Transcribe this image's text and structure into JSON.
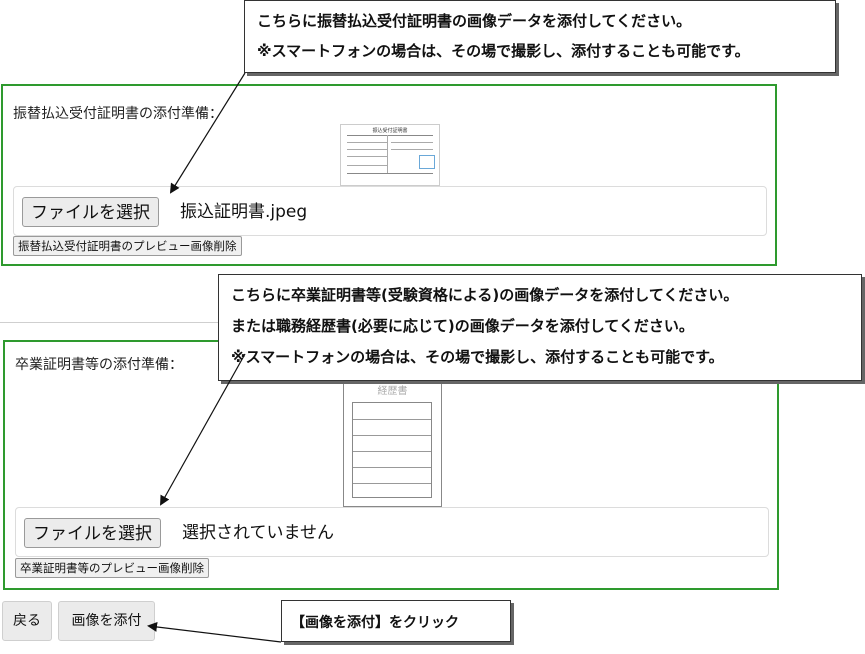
{
  "callout_top": {
    "line1": "こちらに振替払込受付証明書の画像データを添付してください。",
    "line2": "※スマートフォンの場合は、その場で撮影し、添付することも可能です。"
  },
  "section_payment": {
    "label": "振替払込受付証明書の添付準備：",
    "file_button": "ファイルを選択",
    "file_name": "振込証明書.jpeg",
    "delete_button": "振替払込受付証明書のプレビュー画像削除",
    "preview_title": "振込受付証明書"
  },
  "callout_middle": {
    "line1": "こちらに卒業証明書等(受験資格による)の画像データを添付してください。",
    "line2": "または職務経歴書(必要に応じて)の画像データを添付してください。",
    "line3": "※スマートフォンの場合は、その場で撮影し、添付することも可能です。"
  },
  "section_graduation": {
    "label": "卒業証明書等の添付準備：",
    "file_button": "ファイルを選択",
    "file_name": "選択されていません",
    "delete_button": "卒業証明書等のプレビュー画像削除",
    "preview_title": "経歴書"
  },
  "footer": {
    "back_button": "戻る",
    "attach_button": "画像を添付"
  },
  "callout_bottom": {
    "text": "【画像を添付】をクリック"
  },
  "colors": {
    "section_border": "#2e9a2e"
  }
}
